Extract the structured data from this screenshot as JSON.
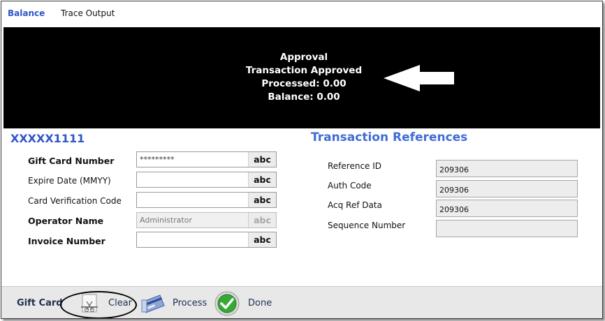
{
  "tabs": {
    "balance": "Balance",
    "trace_output": "Trace Output"
  },
  "banner": {
    "status": "Approval",
    "message": "Transaction Approved",
    "processed": "Processed: 0.00",
    "balance": "Balance: 0.00"
  },
  "card": {
    "masked_number": "XXXXX1111",
    "fields": {
      "gift_card_number": {
        "label": "Gift Card Number",
        "value": "*********",
        "suffix": "abc"
      },
      "expire_date": {
        "label": "Expire Date (MMYY)",
        "value": "",
        "suffix": "abc"
      },
      "cvc": {
        "label": "Card Verification Code",
        "value": "",
        "suffix": "abc"
      },
      "operator_name": {
        "label": "Operator Name",
        "value": "Administrator",
        "suffix": "abc"
      },
      "invoice_number": {
        "label": "Invoice Number",
        "value": "",
        "suffix": "abc"
      }
    }
  },
  "references": {
    "title": "Transaction References",
    "reference_id": {
      "label": "Reference ID",
      "value": "209306"
    },
    "auth_code": {
      "label": "Auth Code",
      "value": "209306"
    },
    "acq_ref_data": {
      "label": "Acq Ref Data",
      "value": "209306"
    },
    "sequence_number": {
      "label": "Sequence Number",
      "value": ""
    }
  },
  "footer": {
    "title": "Gift Card",
    "clear": "Clear",
    "process": "Process",
    "done": "Done"
  },
  "colors": {
    "accent": "#2d56c9",
    "banner_bg": "#000000",
    "footer_bg": "#e8e8e8"
  },
  "icons": [
    "arrow-left-icon",
    "clear-icon",
    "credit-card-icon",
    "checkmark-icon"
  ]
}
